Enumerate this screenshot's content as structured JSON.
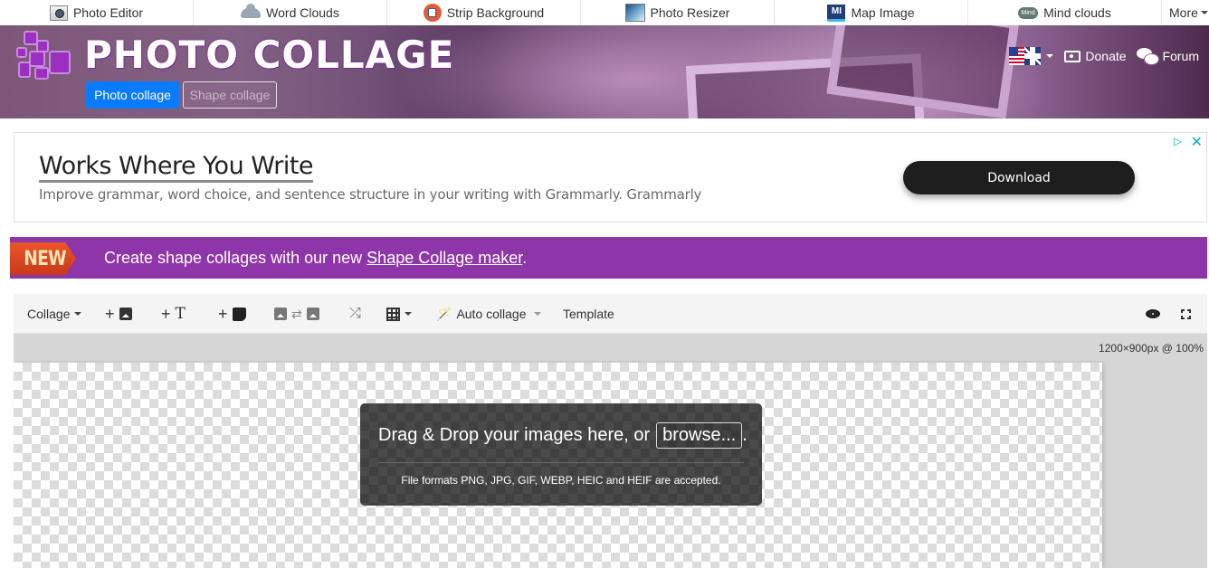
{
  "topnav": {
    "items": [
      {
        "label": "Photo Editor",
        "icon": "photo-editor-icon"
      },
      {
        "label": "Word Clouds",
        "icon": "cloud-icon"
      },
      {
        "label": "Strip Background",
        "icon": "strip-background-icon"
      },
      {
        "label": "Photo Resizer",
        "icon": "photo-resizer-icon"
      },
      {
        "label": "Map Image",
        "icon": "map-image-icon"
      },
      {
        "label": "Mind clouds",
        "icon": "mind-clouds-icon"
      }
    ],
    "more_label": "More",
    "map_icon_text": "MI",
    "mind_icon_text": "Mind"
  },
  "header": {
    "title": "PHOTO COLLAGE",
    "tabs": [
      {
        "label": "Photo collage",
        "active": true
      },
      {
        "label": "Shape collage",
        "active": false
      }
    ],
    "donate_label": "Donate",
    "forum_label": "Forum",
    "language": "English (US/UK flag)"
  },
  "ad": {
    "title": "Works Where You Write",
    "text": "Improve grammar, word choice, and sentence structure in your writing with Grammarly. Grammarly",
    "button_label": "Download",
    "choices_icon": "▷",
    "close_icon": "✕"
  },
  "banner": {
    "badge": "NEW",
    "text_before": "Create shape collages with our new ",
    "link_text": "Shape Collage maker",
    "text_after": "."
  },
  "toolbar": {
    "collage_label": "Collage",
    "auto_collage_label": "Auto collage",
    "template_label": "Template",
    "plus": "+",
    "text_glyph": "T",
    "swap_glyph": "⇄",
    "shuffle_glyph": "⤮",
    "wand_glyph": "🪄"
  },
  "canvas": {
    "size_readout": "1200×900px @ 100%",
    "drop_text": "Drag & Drop your images here, or",
    "browse_label": "browse...",
    "drop_suffix": ".",
    "formats_text": "File formats PNG, JPG, GIF, WEBP, HEIC and HEIF are accepted."
  },
  "colors": {
    "accent_blue": "#0a7bff",
    "banner_purple": "#8e35aa",
    "new_badge": "#e4502a",
    "ad_button": "#1e1e1e"
  }
}
